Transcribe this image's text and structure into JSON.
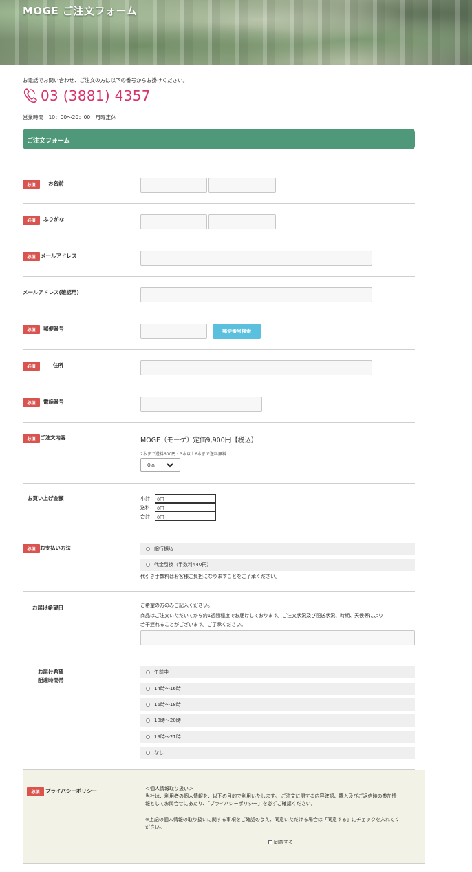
{
  "header": {
    "title": "MOGE ご注文フォーム"
  },
  "contact": {
    "note": "お電話でお問い合わせ、ご注文の方は以下の番号からお掛けください。",
    "phone": "03 (3881) 4357",
    "hours": "営業時間　10：00〜20：00　月曜定休"
  },
  "section": {
    "title": "ご注文フォーム"
  },
  "required_badge": "必須",
  "fields": {
    "name": {
      "label": "お名前"
    },
    "kana": {
      "label": "ふりがな"
    },
    "email": {
      "label": "メールアドレス"
    },
    "email_confirm": {
      "label": "メールアドレス(確認用)"
    },
    "zip": {
      "label": "郵便番号",
      "button": "郵便番号検索"
    },
    "address": {
      "label": "住所"
    },
    "phone": {
      "label": "電話番号"
    },
    "order": {
      "label": "ご注文内容",
      "product": "MOGE（モーゲ）定価9,900円【税込】",
      "shipping_note": "2本まで送料600円・3本以上6本まで送料無料",
      "qty_value": "0本"
    },
    "total": {
      "label": "お買い上げ金額",
      "lines": [
        {
          "label": "小計",
          "value": "0円"
        },
        {
          "label": "送料",
          "value": "0円"
        },
        {
          "label": "合計",
          "value": "0円"
        }
      ]
    },
    "payment": {
      "label": "お支払い方法",
      "options": [
        "銀行振込",
        "代金引換（手数料440円）"
      ],
      "note": "代引き手数料はお客様ご負担になりますことをご了承ください。"
    },
    "delivery_date": {
      "label": "お届け希望日",
      "note1": "ご希望の方のみご記入ください。",
      "note2": "商品はご注文いただいてから約1週間程度でお届けしております。ご注文状況及び配送状況、時期、天候等により",
      "note3": "若干遅れることがございます。ご了承ください。"
    },
    "delivery_time": {
      "label1": "お届け希望",
      "label2": "配達時間帯",
      "options": [
        "午前中",
        "14時〜16時",
        "16時〜18時",
        "18時〜20時",
        "19時〜21時",
        "なし"
      ]
    },
    "privacy": {
      "label": "プライバシーポリシー",
      "line1": "＜個人情報取り扱い＞",
      "line2": "当社は、利用者の個人情報を、以下の目的で利用いたします。 ご注文に関する内容確認、購入及びご返信時の参加情",
      "line3": "報としてお問合せにあたり、「プライバシーポリシー」を必ずご確認ください。",
      "line4": "※上記の個人情報の取り扱いに関する事項をご確認のうえ、同意いただける場合は「同意する」にチェックを入れてく",
      "line5": "ださい。",
      "agree": "同意する"
    }
  },
  "colors": {
    "accent": "#4f9879",
    "required": "#d9534f",
    "phone": "#d6336c",
    "zip_button": "#5bc0de"
  }
}
